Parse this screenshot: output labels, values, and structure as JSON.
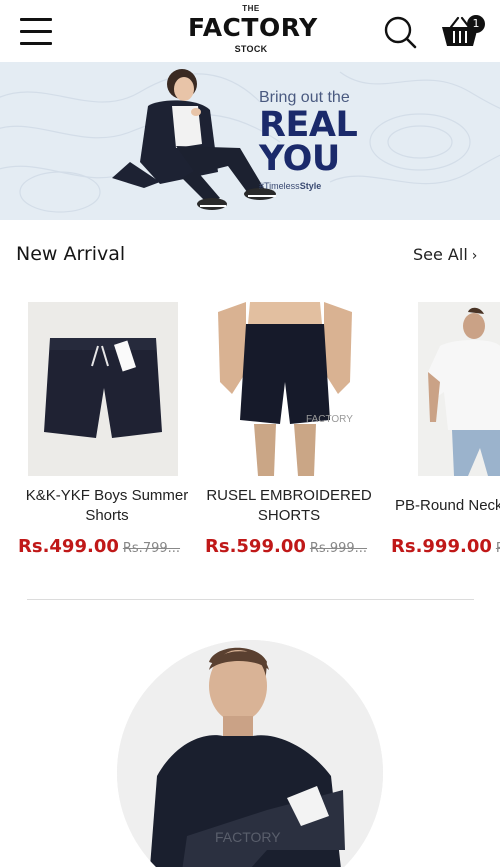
{
  "header": {
    "logo_top": "THE",
    "logo_main": "FACTORY",
    "logo_bottom": "STOCK",
    "icons": {
      "menu": "hamburger-menu-icon",
      "search": "search-icon",
      "cart": "basket-icon"
    },
    "cart_count": "1"
  },
  "banner": {
    "line1": "Bring out the",
    "line2": "REAL",
    "line3": "YOU",
    "hashtag_prefix": "#Timeless",
    "hashtag_bold": "Style"
  },
  "new_arrival": {
    "title": "New Arrival",
    "see_all": "See All",
    "products": [
      {
        "name": "K&K-YKF Boys Summer Shorts",
        "price": "Rs.499.00",
        "old_price": "Rs.799..."
      },
      {
        "name": "RUSEL EMBROIDERED SHORTS",
        "price": "Rs.599.00",
        "old_price": "Rs.999..."
      },
      {
        "name": "PB-Round Neck",
        "price": "Rs.999.00",
        "old_price": "R"
      }
    ],
    "watermark": "FACTORY"
  },
  "colors": {
    "price_red": "#c01818",
    "banner_navy": "#1b2a6b",
    "banner_bg": "#e4ecf3"
  }
}
